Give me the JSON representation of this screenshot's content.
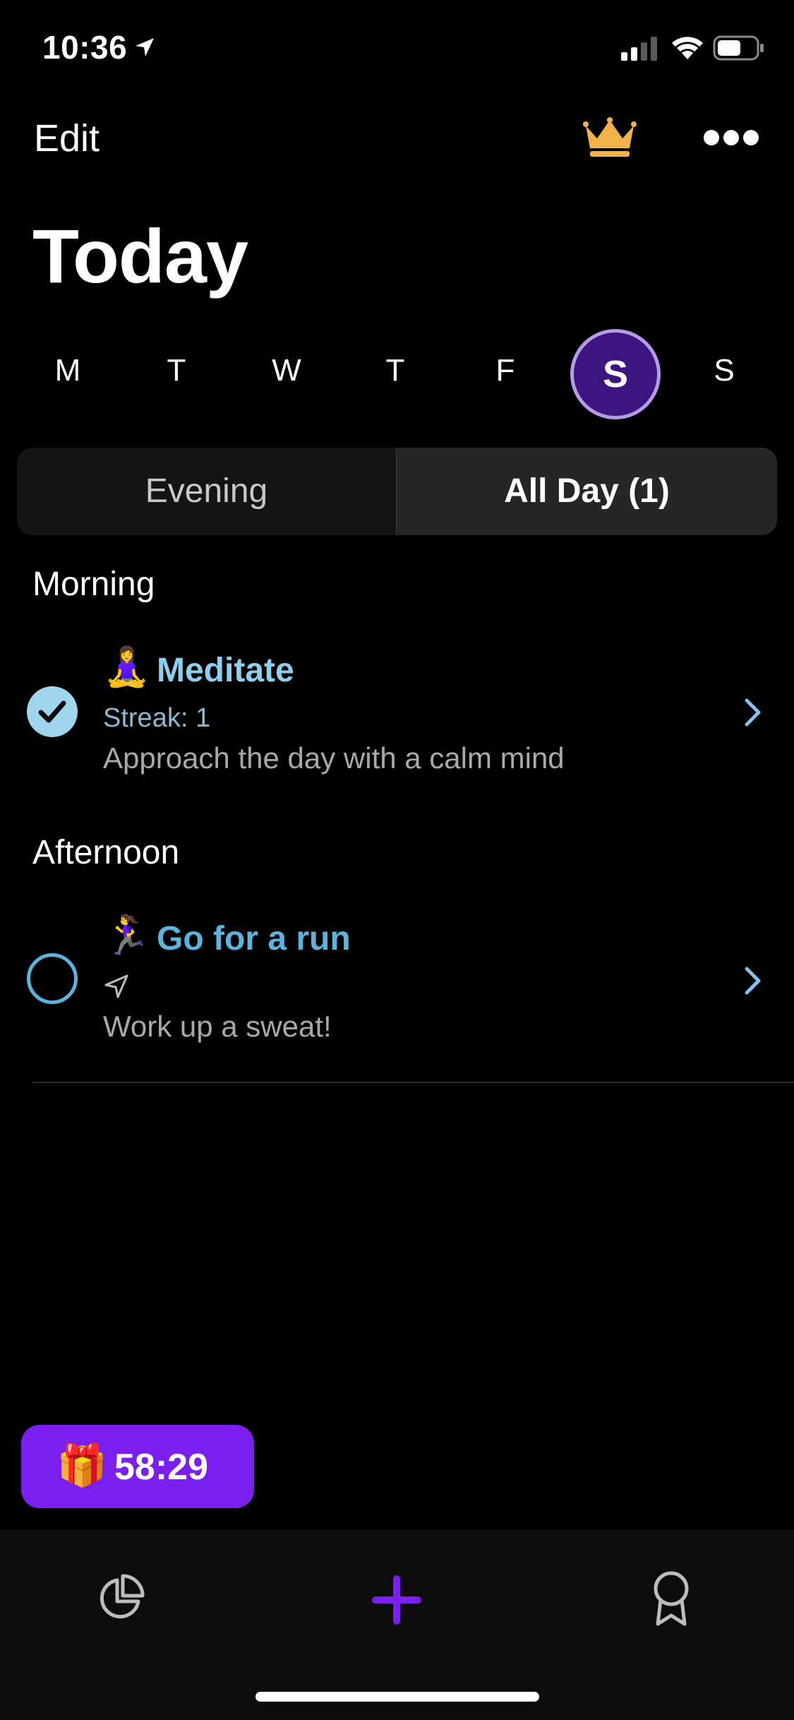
{
  "status_bar": {
    "time": "10:36"
  },
  "header": {
    "edit_label": "Edit",
    "title": "Today"
  },
  "week": {
    "days": [
      "M",
      "T",
      "W",
      "T",
      "F",
      "S",
      "S"
    ],
    "selected_index": 5
  },
  "segments": {
    "left": "Evening",
    "right": "All Day (1)",
    "active": "right"
  },
  "sections": {
    "morning": {
      "label": "Morning",
      "task": {
        "emoji": "🧘‍♀️",
        "title": "Meditate",
        "streak": "Streak: 1",
        "description": "Approach the day with a calm mind",
        "completed": true
      }
    },
    "afternoon": {
      "label": "Afternoon",
      "task": {
        "emoji": "🏃‍♀️",
        "title": "Go for a run",
        "description": "Work up a sweat!",
        "completed": false
      }
    }
  },
  "promo": {
    "emoji": "🎁",
    "timer": "58:29"
  },
  "colors": {
    "accent": "#7a1ff0",
    "task_title": "#8fcfee",
    "selected_day_bg": "#3d1580",
    "check": "#9fd6ee"
  },
  "tabbar": {
    "icons": [
      "pie-chart-icon",
      "plus-icon",
      "award-icon"
    ]
  }
}
